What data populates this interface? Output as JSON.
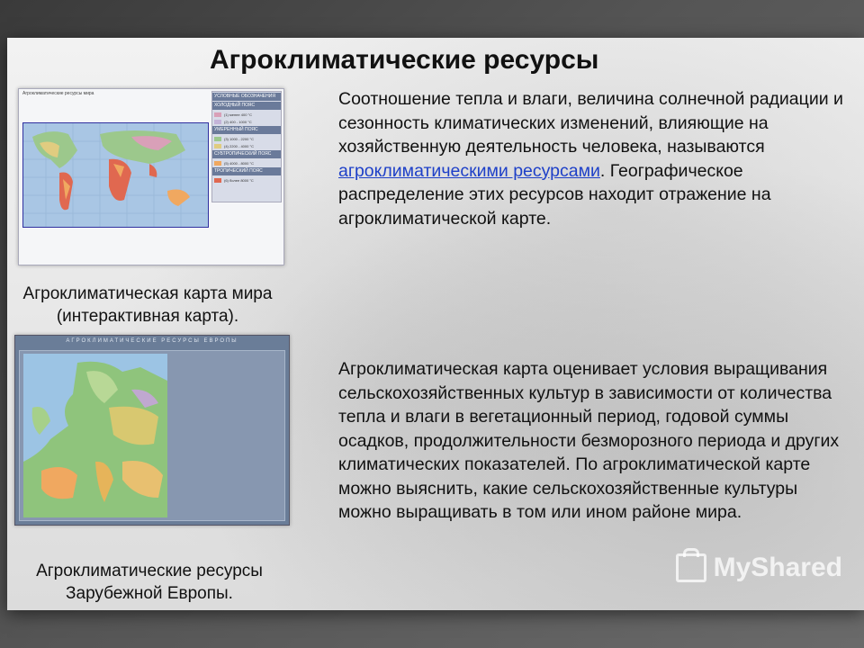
{
  "slide": {
    "title": "Агроклиматические ресурсы",
    "paragraph1": {
      "before_link": "Соотношение тепла и влаги, величина солнечной радиации и сезонность климатических изменений, влияющие на хозяйственную деятельность человека, называются ",
      "link_text": "агроклиматическими ресурсами",
      "after_link": ". Географическое распределение этих ресурсов находит отражение на агроклиматической карте."
    },
    "paragraph2": "Агроклиматическая карта оценивает условия выращивания сельскохозяйственных культур в зависимости от количества тепла и влаги в вегетационный период, годовой суммы осадков, продолжительности безморозного периода и других климатических показателей. По агроклиматической карте можно выяснить, какие сельскохозяйственные культуры можно выращивать в том или ином районе мира.",
    "caption1_line1": "Агроклиматическая карта мира",
    "caption1_line2": "(интерактивная  карта).",
    "caption2_line1": "Агроклиматические ресурсы",
    "caption2_line2": "Зарубежной Европы."
  },
  "world_map": {
    "header": "Агроклиматические ресурсы мира",
    "legend_title": "УСЛОВНЫЕ ОБОЗНАЧЕНИЯ",
    "legend": [
      {
        "zone": "ХОЛОДНЫЙ ПОЯС",
        "rows": [
          {
            "color": "#d9a0b8",
            "label": "(1) менее 400 °C"
          },
          {
            "color": "#c4b4d8",
            "label": "(2) 400 - 1000 °C"
          }
        ]
      },
      {
        "zone": "УМЕРЕННЫЙ ПОЯС",
        "rows": [
          {
            "color": "#9cc88c",
            "label": "(3) 1000 - 2200 °C"
          },
          {
            "color": "#e0cc80",
            "label": "(4) 2200 - 4000 °C"
          }
        ]
      },
      {
        "zone": "СУБТРОПИЧЕСКИЙ ПОЯС",
        "rows": [
          {
            "color": "#f0a860",
            "label": "(5) 4000 - 8000 °C"
          }
        ]
      },
      {
        "zone": "ТРОПИЧЕСКИЙ ПОЯС",
        "rows": [
          {
            "color": "#e06850",
            "label": "(6) более 8000 °C"
          }
        ]
      }
    ]
  },
  "europe_map": {
    "header": "АГРОКЛИМАТИЧЕСКИЕ РЕСУРСЫ ЕВРОПЫ"
  },
  "watermark": "MyShared",
  "colors": {
    "link": "#1e40c8",
    "text": "#111111",
    "map_border": "#3030a0"
  }
}
